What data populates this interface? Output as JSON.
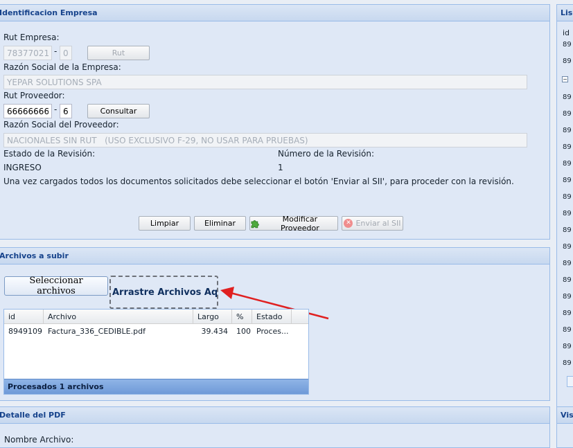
{
  "empresa_panel": {
    "title": "Identificacion Empresa",
    "rut_empresa_label": "Rut Empresa:",
    "rut_empresa_value": "78377021",
    "rut_empresa_dv": "0",
    "rut_button": "Rut",
    "razon_empresa_label": "Razón Social de la Empresa:",
    "razon_empresa_value": "YEPAR SOLUTIONS SPA",
    "rut_proveedor_label": "Rut Proveedor:",
    "rut_proveedor_value": "66666666",
    "rut_proveedor_dv": "6",
    "consultar_button": "Consultar",
    "razon_proveedor_label": "Razón Social del Proveedor:",
    "razon_proveedor_value": "NACIONALES SIN RUT   (USO EXCLUSIVO F-29, NO USAR PARA PRUEBAS)",
    "estado_label": "Estado de la Revisión:",
    "estado_value": "INGRESO",
    "numero_label": "Número de la Revisión:",
    "numero_value": "1",
    "instructions": "Una vez cargados todos los documentos solicitados debe seleccionar el botón 'Enviar al SII', para proceder con la revisión.",
    "buttons": {
      "limpiar": "Limpiar",
      "eliminar": "Eliminar",
      "modificar": "Modificar Proveedor",
      "enviar": "Enviar al SII"
    }
  },
  "archivos_panel": {
    "title": "Archivos a subir",
    "select_button": "Seleccionar archivos",
    "dropzone_text": "Arrastre Archivos Aquí",
    "columns": [
      "id",
      "Archivo",
      "Largo",
      "%",
      "Estado"
    ],
    "rows": [
      {
        "id": "8949109",
        "archivo": "Factura_336_CEDIBLE.pdf",
        "largo": "39.434",
        "pct": "100",
        "estado": "Proces..."
      }
    ],
    "footer": "Procesados 1 archivos"
  },
  "detalle_panel": {
    "title": "Detalle del PDF",
    "nombre_label": "Nombre Archivo:"
  },
  "right_panel": {
    "title": "Lis",
    "col_id": "id",
    "visor_title": "Vis",
    "items": [
      "89",
      "89",
      "89",
      "89",
      "89",
      "89",
      "89",
      "89",
      "89",
      "89",
      "89",
      "89",
      "89",
      "89",
      "89",
      "89",
      "89",
      "89",
      "89"
    ]
  },
  "colors": {
    "panel_bg": "#dfe8f6",
    "header_text": "#15428b",
    "border": "#99bbe8",
    "arrow": "#e02020"
  }
}
